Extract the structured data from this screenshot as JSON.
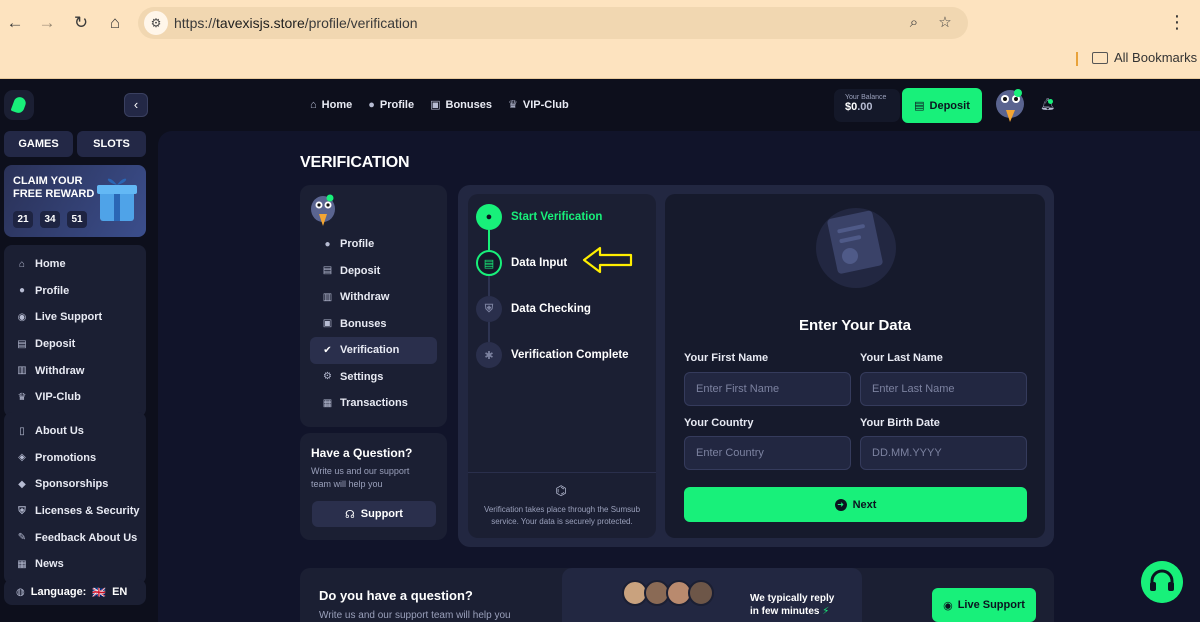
{
  "browser": {
    "url_scheme": "https://",
    "url_host": "tavexisjs.store",
    "url_path": "/profile/verification",
    "bookmarks_label": "All Bookmarks"
  },
  "topnav": {
    "items": [
      {
        "label": "Home",
        "icon": "home-icon"
      },
      {
        "label": "Profile",
        "icon": "user-icon"
      },
      {
        "label": "Bonuses",
        "icon": "gift-icon"
      },
      {
        "label": "VIP-Club",
        "icon": "crown-icon"
      }
    ],
    "balance_label": "Your Balance",
    "balance_dollars": "$0",
    "balance_cents": ".00",
    "deposit_label": "Deposit"
  },
  "sidebar": {
    "games_label": "GAMES",
    "slots_label": "SLOTS",
    "reward_title": "CLAIM YOUR FREE REWARD",
    "timer": [
      "21",
      "34",
      "51"
    ],
    "main_items": [
      "Home",
      "Profile",
      "Live Support",
      "Deposit",
      "Withdraw",
      "VIP-Club"
    ],
    "info_items": [
      "About Us",
      "Promotions",
      "Sponsorships",
      "Licenses & Security",
      "Feedback About Us",
      "News"
    ],
    "language_label": "Language:",
    "language_flag": "🇬🇧",
    "language_code": "EN"
  },
  "page": {
    "title": "VERIFICATION"
  },
  "profile_menu": {
    "items": [
      "Profile",
      "Deposit",
      "Withdraw",
      "Bonuses",
      "Verification",
      "Settings",
      "Transactions"
    ],
    "active": "Verification"
  },
  "question_card": {
    "title": "Have a Question?",
    "subtitle": "Write us and our support team will help you",
    "button": "Support"
  },
  "steps": {
    "items": [
      {
        "label": "Start Verification",
        "state": "done"
      },
      {
        "label": "Data Input",
        "state": "current"
      },
      {
        "label": "Data Checking",
        "state": "pending"
      },
      {
        "label": "Verification Complete",
        "state": "pending"
      }
    ],
    "footer": "Verification takes place through the Sumsub service. Your data is securely protected."
  },
  "form": {
    "title": "Enter Your Data",
    "first_name_label": "Your First Name",
    "first_name_placeholder": "Enter First Name",
    "last_name_label": "Your Last Name",
    "last_name_placeholder": "Enter Last Name",
    "country_label": "Your Country",
    "country_placeholder": "Enter Country",
    "birth_label": "Your Birth Date",
    "birth_placeholder": "DD.MM.YYYY",
    "next_label": "Next"
  },
  "bottom": {
    "title": "Do you have a question?",
    "subtitle": "Write us and our support team will help you",
    "reply_line1": "We typically reply",
    "reply_line2": "in few minutes",
    "live_support": "Live Support"
  },
  "colors": {
    "accent": "#18f07a",
    "bg": "#0d0f1c",
    "card": "#1b1f33",
    "annotation_arrow": "#ffee00"
  }
}
